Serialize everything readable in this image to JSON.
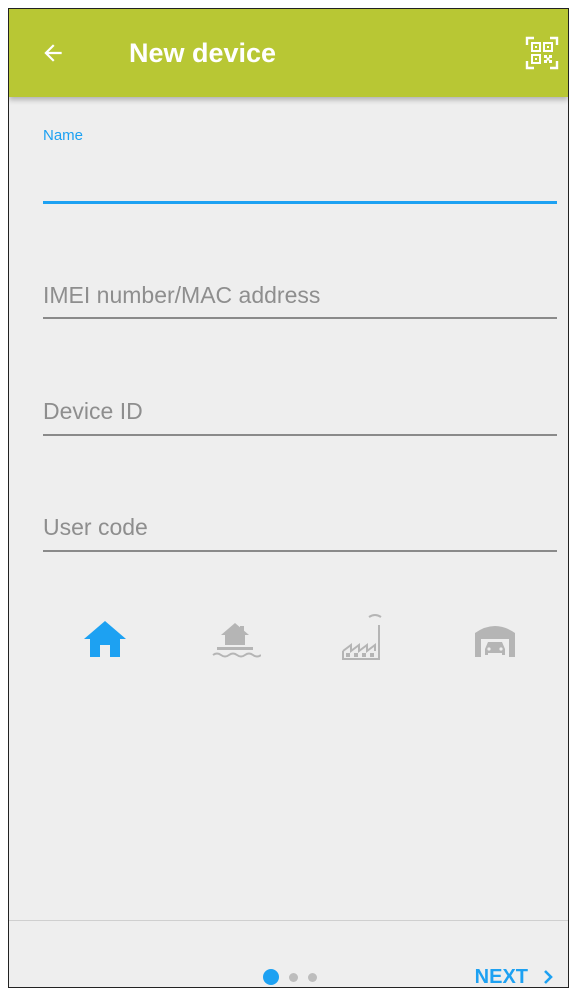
{
  "app_bar": {
    "title": "New device",
    "back_icon": "arrow-left-icon",
    "qr_icon": "qr-code-scan-icon",
    "color": "#b8c734"
  },
  "form": {
    "name": {
      "label": "Name",
      "value": ""
    },
    "imei": {
      "placeholder": "IMEI number/MAC address",
      "value": ""
    },
    "device_id": {
      "placeholder": "Device ID",
      "value": ""
    },
    "user_code": {
      "placeholder": "User code",
      "value": ""
    }
  },
  "device_types": [
    {
      "icon": "house-icon",
      "selected": true
    },
    {
      "icon": "flood-house-icon",
      "selected": false
    },
    {
      "icon": "factory-icon",
      "selected": false
    },
    {
      "icon": "garage-icon",
      "selected": false
    }
  ],
  "pager": {
    "current_page": 1,
    "total_pages": 3
  },
  "footer": {
    "next_label": "NEXT"
  },
  "colors": {
    "accent": "#1da1f2",
    "inactive_icon": "#b5b5b5",
    "background": "#eeeeee"
  }
}
